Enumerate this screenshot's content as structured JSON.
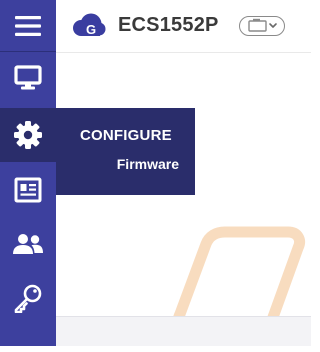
{
  "header": {
    "device_name": "ECS1552P"
  },
  "flyout": {
    "title": "CONFIGURE",
    "items": [
      {
        "label": "Firmware"
      }
    ]
  },
  "sidebar": {
    "items": [
      {
        "icon": "hamburger-menu-icon"
      },
      {
        "icon": "monitor-icon"
      },
      {
        "icon": "gear-icon",
        "active": true
      },
      {
        "icon": "newspaper-icon"
      },
      {
        "icon": "users-icon"
      },
      {
        "icon": "key-icon"
      }
    ]
  },
  "colors": {
    "sidebar": "#3d409e",
    "sidebar_active": "#2a2d6b",
    "logo": "#3a3da0",
    "watermark": "#f7d6b4"
  }
}
